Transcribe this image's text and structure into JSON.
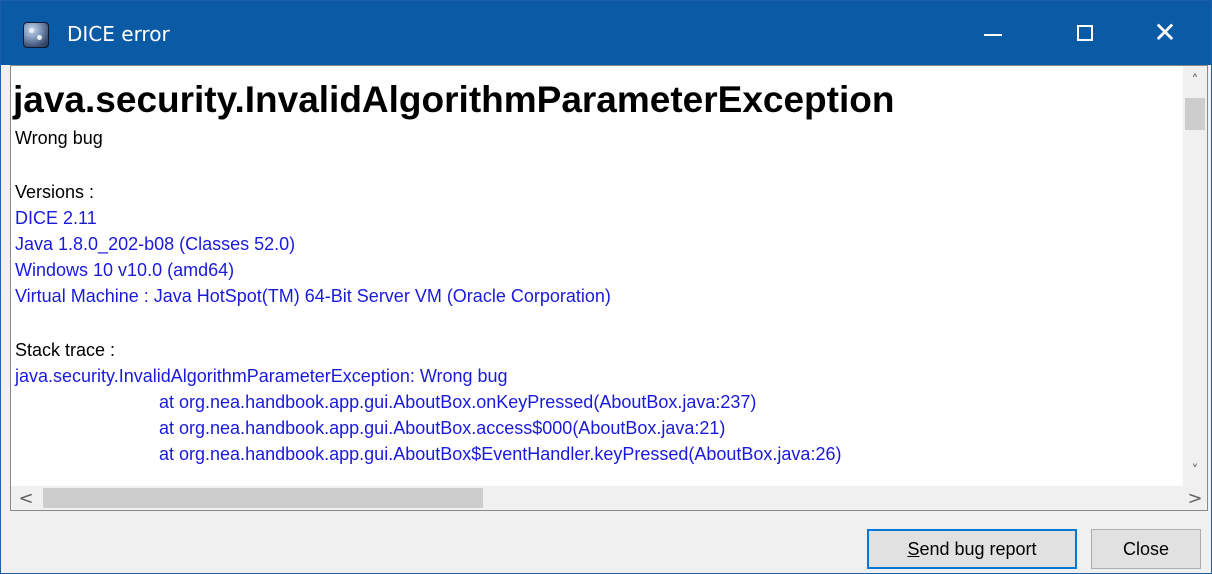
{
  "window": {
    "title": "DICE error",
    "app_icon": "dice-icon",
    "controls": {
      "minimize_icon": "minimize-icon",
      "maximize_icon": "maximize-icon",
      "close_icon": "close-icon",
      "close_glyph": "✕"
    }
  },
  "error": {
    "heading": "java.security.InvalidAlgorithmParameterException",
    "message": "Wrong bug"
  },
  "versions": {
    "label": "Versions :",
    "items": [
      "DICE 2.11",
      "Java 1.8.0_202-b08 (Classes 52.0)",
      "Windows 10 v10.0 (amd64)",
      "Virtual Machine : Java HotSpot(TM) 64-Bit Server VM (Oracle Corporation)"
    ]
  },
  "stack_trace": {
    "label": "Stack trace :",
    "lines": [
      "java.security.InvalidAlgorithmParameterException: Wrong bug",
      "at org.nea.handbook.app.gui.AboutBox.onKeyPressed(AboutBox.java:237)",
      "at org.nea.handbook.app.gui.AboutBox.access$000(AboutBox.java:21)",
      "at org.nea.handbook.app.gui.AboutBox$EventHandler.keyPressed(AboutBox.java:26)"
    ]
  },
  "scrollbars": {
    "up_glyph": "˄",
    "down_glyph": "˅",
    "left_glyph": "<",
    "right_glyph": ">"
  },
  "buttons": {
    "send_bug_report": "Send bug report",
    "close": "Close"
  },
  "colors": {
    "titlebar": "#0a5aa5",
    "link_text": "#1a1adc",
    "focus_border": "#0078d7"
  }
}
